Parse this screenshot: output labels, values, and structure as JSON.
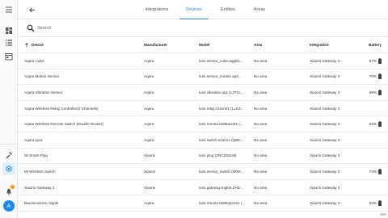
{
  "nav": {
    "tabs": [
      {
        "label": "Integrations",
        "active": false
      },
      {
        "label": "Devices",
        "active": true
      },
      {
        "label": "Entities",
        "active": false
      },
      {
        "label": "Areas",
        "active": false
      }
    ],
    "icons": [
      "back-arrow-icon"
    ]
  },
  "rail": {
    "icons": [
      "dashboard-icon",
      "list-icon",
      "calendar-icon",
      "hammer-icon",
      "gear-icon",
      "bell-icon"
    ],
    "avatar_initial": "A",
    "accent": "#1e88e5"
  },
  "search": {
    "placeholder": "Search",
    "value": ""
  },
  "table": {
    "headers": {
      "device": "Device",
      "manufacturer": "Manufacturer",
      "model": "Model",
      "area": "Area",
      "integration": "Integration",
      "battery": "Battery"
    },
    "rows": [
      {
        "device": "Aqara Cube",
        "manufacturer": "Aqara",
        "model": "lumi.sensor_cube.aqgl01...",
        "area": "No area",
        "integration": "Xiaomi Gateway 3",
        "battery": "67%"
      },
      {
        "device": "Aqara Motion Sensor",
        "manufacturer": "Aqara",
        "model": "lumi.sensor_motion.aq2...",
        "area": "No area",
        "integration": "Xiaomi Gateway 3",
        "battery": "70%"
      },
      {
        "device": "Aqara Vibration Sensor",
        "manufacturer": "Aqara",
        "model": "lumi.vibration.aq1 (LJT11...",
        "area": "No area",
        "integration": "Xiaomi Gateway 3",
        "battery": "69%"
      },
      {
        "device": "Aqara Wireless Relay Controller(2 Channels)",
        "manufacturer": "Aqara",
        "model": "lumi.relay.c2acn01 (LLKZ...",
        "area": "No area",
        "integration": "Xiaomi Gateway 3",
        "battery": ""
      },
      {
        "device": "Aqara Wireless Remote Switch (Double Rocker)",
        "manufacturer": "Aqara",
        "model": "lumi.remote.b286acn01 (...",
        "area": "No area",
        "integration": "Xiaomi Gateway 3",
        "battery": "53%"
      },
      {
        "device": "Aqara pyra",
        "manufacturer": "Aqara",
        "model": "lumi.switch.n1acn1 (QBK...",
        "area": "No area",
        "integration": "Xiaomi Gateway 3",
        "battery": ""
      },
      {
        "device": "Mi Smart Plug",
        "manufacturer": "Xiaomi",
        "model": "lumi.plug (ZNCZ02LM)",
        "area": "No area",
        "integration": "Xiaomi Gateway 3",
        "battery": ""
      },
      {
        "device": "Mi Wireless Switch",
        "manufacturer": "Xiaomi",
        "model": "lumi.sensor_switch (WXK...",
        "area": "No area",
        "integration": "Xiaomi Gateway 3",
        "battery": "73%"
      },
      {
        "device": "Xiaomi Gateway 3",
        "manufacturer": "Xiaomi",
        "model": "lumi.gateway.mgl03 ZND...",
        "area": "No area",
        "integration": "Xiaomi Gateway 3",
        "battery": ""
      },
      {
        "device": "Выключатель Opple",
        "manufacturer": "Aqara",
        "model": "lumi.remote.b686opcn01 (...",
        "area": "No area",
        "integration": "Xiaomi Gateway 3",
        "battery": "84%"
      }
    ]
  }
}
